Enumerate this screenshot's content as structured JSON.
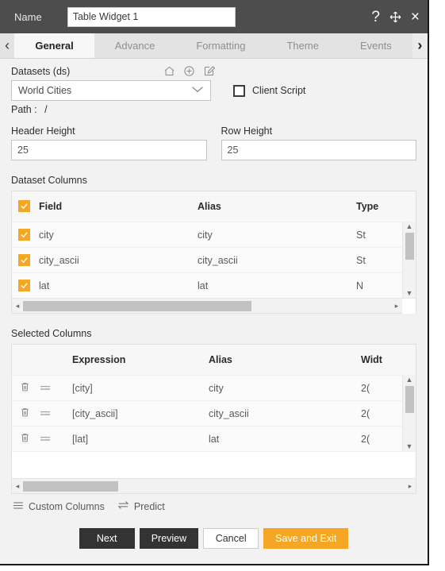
{
  "titlebar": {
    "name_label": "Name",
    "widget_name": "Table Widget 1",
    "help_icon": "?",
    "close_icon": "×"
  },
  "tabs": {
    "prev_icon": "‹",
    "next_icon": "›",
    "items": [
      {
        "label": "General"
      },
      {
        "label": "Advance"
      },
      {
        "label": "Formatting"
      },
      {
        "label": "Theme"
      },
      {
        "label": "Events"
      }
    ],
    "active": "General"
  },
  "general": {
    "datasets_label": "Datasets (ds)",
    "dataset_value": "World Cities",
    "dropdown_chevron": "∨",
    "client_script_label": "Client Script",
    "client_script_checked": false,
    "path_label": "Path :",
    "path_value": "/",
    "header_height_label": "Header Height",
    "header_height_value": "25",
    "row_height_label": "Row Height",
    "row_height_value": "25"
  },
  "dataset_columns": {
    "section_title": "Dataset Columns",
    "headers": {
      "field": "Field",
      "alias": "Alias",
      "type": "Type"
    },
    "rows": [
      {
        "checked": true,
        "field": "city",
        "alias": "city",
        "type": "St"
      },
      {
        "checked": true,
        "field": "city_ascii",
        "alias": "city_ascii",
        "type": "St"
      },
      {
        "checked": true,
        "field": "lat",
        "alias": "lat",
        "type": "N"
      }
    ],
    "select_all_checked": true,
    "scroll_left_arrow": "◂",
    "scroll_right_arrow": "▸",
    "scroll_up_arrow": "▲",
    "scroll_down_arrow": "▼"
  },
  "selected_columns": {
    "section_title": "Selected Columns",
    "headers": {
      "expression": "Expression",
      "alias": "Alias",
      "width": "Widt"
    },
    "rows": [
      {
        "expression": "[city]",
        "alias": "city",
        "width": "2("
      },
      {
        "expression": "[city_ascii]",
        "alias": "city_ascii",
        "width": "2("
      },
      {
        "expression": "[lat]",
        "alias": "lat",
        "width": "2("
      }
    ],
    "scroll_left_arrow": "◂",
    "scroll_right_arrow": "▸",
    "scroll_up_arrow": "▲",
    "scroll_down_arrow": "▼"
  },
  "footer": {
    "custom_columns_label": "Custom Columns",
    "predict_label": "Predict",
    "buttons": {
      "next": "Next",
      "preview": "Preview",
      "cancel": "Cancel",
      "save_and_exit": "Save and Exit"
    }
  },
  "colors": {
    "accent": "#f5a623",
    "titlebar": "#4d4d4d",
    "dark_button": "#333333"
  }
}
